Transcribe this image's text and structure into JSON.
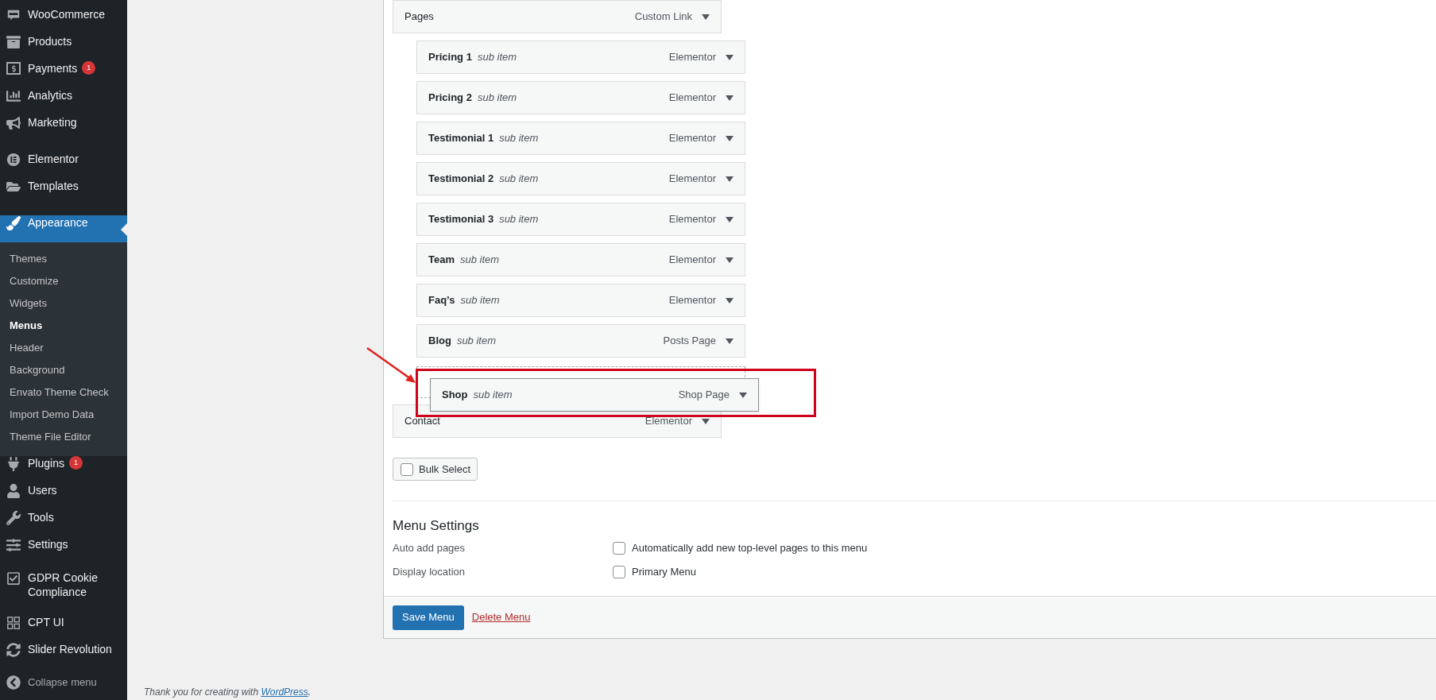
{
  "sidebar": {
    "groups": [
      [
        {
          "label": "WooCommerce",
          "selected": false
        },
        {
          "label": "Products",
          "selected": false
        },
        {
          "label": "Payments",
          "badge": "1",
          "selected": false
        },
        {
          "label": "Analytics",
          "selected": false
        },
        {
          "label": "Marketing",
          "selected": false
        }
      ],
      [
        {
          "label": "Elementor",
          "selected": false
        },
        {
          "label": "Templates",
          "selected": false
        }
      ],
      [
        {
          "label": "Appearance",
          "selected": true,
          "children": [
            {
              "label": "Themes",
              "selected": false
            },
            {
              "label": "Customize",
              "selected": false
            },
            {
              "label": "Widgets",
              "selected": false
            },
            {
              "label": "Menus",
              "selected": true
            },
            {
              "label": "Header",
              "selected": false
            },
            {
              "label": "Background",
              "selected": false
            },
            {
              "label": "Envato Theme Check",
              "selected": false
            },
            {
              "label": "Import Demo Data",
              "selected": false
            },
            {
              "label": "Theme File Editor",
              "selected": false
            }
          ]
        },
        {
          "label": "Plugins",
          "badge": "1",
          "selected": false
        },
        {
          "label": "Users",
          "selected": false
        },
        {
          "label": "Tools",
          "selected": false
        },
        {
          "label": "Settings",
          "selected": false
        },
        {
          "label": "GDPR Cookie Compliance",
          "selected": false
        }
      ],
      [
        {
          "label": "CPT UI",
          "selected": false
        },
        {
          "label": "Slider Revolution",
          "selected": false
        }
      ]
    ],
    "collapse": {
      "label": "Collapse menu"
    }
  },
  "menu": {
    "items": [
      {
        "title": "Pages",
        "type": "Custom Link",
        "children": [
          {
            "title": "Pricing 1",
            "sub_label": "sub item",
            "type": "Elementor",
            "dragging": false
          },
          {
            "title": "Pricing 2",
            "sub_label": "sub item",
            "type": "Elementor",
            "dragging": false
          },
          {
            "title": "Testimonial 1",
            "sub_label": "sub item",
            "type": "Elementor",
            "dragging": false
          },
          {
            "title": "Testimonial 2",
            "sub_label": "sub item",
            "type": "Elementor",
            "dragging": false
          },
          {
            "title": "Testimonial 3",
            "sub_label": "sub item",
            "type": "Elementor",
            "dragging": false
          },
          {
            "title": "Team",
            "sub_label": "sub item",
            "type": "Elementor",
            "dragging": false
          },
          {
            "title": "Faq’s",
            "sub_label": "sub item",
            "type": "Elementor",
            "dragging": false
          },
          {
            "title": "Blog",
            "sub_label": "sub item",
            "type": "Posts Page",
            "dragging": false
          },
          {
            "title": "Shop",
            "sub_label": "sub item",
            "type": "Shop Page",
            "dragging": true
          }
        ]
      },
      {
        "title": "Contact",
        "type": "Elementor"
      }
    ],
    "bulk_select": {
      "label": "Bulk Select",
      "checked": false
    }
  },
  "menu_settings": {
    "title": "Menu Settings",
    "rows": [
      {
        "label": "Auto add pages",
        "option": "Automatically add new top-level pages to this menu",
        "checked": false
      },
      {
        "label": "Display location",
        "option": "Primary Menu",
        "checked": false
      }
    ]
  },
  "actions": {
    "save": "Save Menu",
    "delete": "Delete Menu"
  },
  "footer": {
    "text": "Thank you for creating with",
    "link": "WordPress",
    "suffix": "."
  }
}
